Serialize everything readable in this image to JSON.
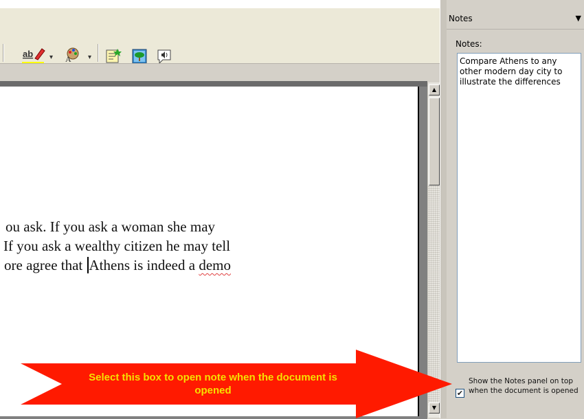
{
  "document": {
    "line1": "ou ask. If you ask a woman she may",
    "line2": " If you ask a wealthy citizen he may tell",
    "line3_before": "ore agree that ",
    "line3_after_plain": "Athens is indeed a ",
    "line3_squiggle": "demo"
  },
  "notes_panel": {
    "header_title": "Notes",
    "menu_glyph": "▼",
    "label": "Notes:",
    "note_text": "Compare Athens to any other modern day city to illustrate the differences",
    "checkbox_checked": true,
    "checkbox_mark": "✔",
    "checkbox_label": "Show the Notes panel on top when the document is opened"
  },
  "callout": {
    "text": "Select this box to open note when the document is opened",
    "fill_color": "#ff1a00",
    "text_color": "#f6e000"
  },
  "scrollbar": {
    "up_glyph": "▲",
    "down_glyph": "▼"
  },
  "toolbar": {
    "icons": [
      "highlighter-icon",
      "font-color-icon",
      "insert-note-icon",
      "picture-icon",
      "speak-icon"
    ],
    "dropdown_glyph": "▾"
  }
}
